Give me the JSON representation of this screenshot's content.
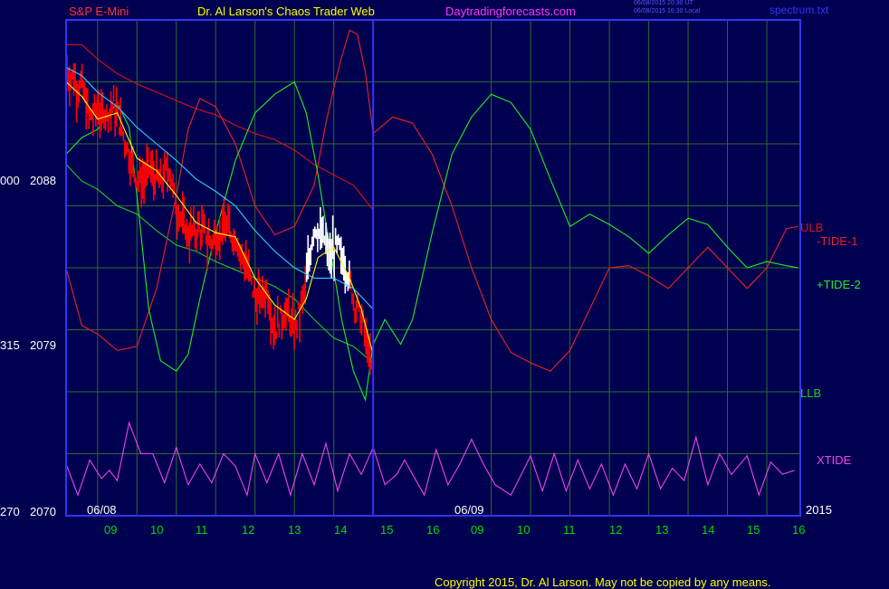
{
  "header": {
    "instrument": "S&P E-Mini",
    "site_title": "Dr. Al Larson's Chaos Trader Web",
    "site_url": "Daytradingforecasts.com",
    "time_line_1": "06/08/2015 20:30 UT",
    "time_line_2": "06/08/2015 16:30 Local",
    "filename": "spectrum.txt"
  },
  "footer": {
    "copyright": "Copyright 2015, Dr. Al Larson. May not be copied by any means."
  },
  "colors": {
    "background": "#000050",
    "frame": "#3333ff",
    "grid": "#2e6b2e",
    "price_bar": "#ff0000",
    "price_bar_forecast": "#ffffff",
    "ulb": "#dd1111",
    "llb": "#22cc22",
    "tide_minus_1": "#ee2222",
    "tide_plus_2": "#22ee22",
    "xtide": "#ee44ee",
    "avg_yellow": "#ffff00",
    "avg_cyan": "#33ccff",
    "header_red": "#ff3333",
    "header_yellow": "#ffff00",
    "header_magenta": "#ff33ff"
  },
  "chart_data": {
    "type": "line",
    "title": "S&P E-Mini",
    "y_axis": {
      "range": [
        2070,
        2094
      ],
      "ticks": [
        {
          "value": 2088,
          "label": "2088",
          "left_label": "000"
        },
        {
          "value": 2079,
          "label": "2079",
          "left_label": "315"
        },
        {
          "value": 2070,
          "label": "2070",
          "left_label": "270"
        }
      ]
    },
    "x_axis": {
      "hours": [
        "09",
        "10",
        "11",
        "12",
        "13",
        "14",
        "15",
        "16",
        "09",
        "10",
        "11",
        "12",
        "13",
        "14",
        "15",
        "16"
      ],
      "date_labels": [
        "06/08",
        "06/09"
      ],
      "year_label": "2015",
      "grid": true
    },
    "legend": [
      {
        "label": "ULB",
        "color": "#dd1111"
      },
      {
        "label": "-TIDE-1",
        "color": "#ee2222"
      },
      {
        "label": "+TIDE-2",
        "color": "#22ee22"
      },
      {
        "label": "LLB",
        "color": "#22cc22"
      },
      {
        "label": "XTIDE",
        "color": "#ee44ee"
      }
    ],
    "price_path": [
      [
        8.2,
        2091.5
      ],
      [
        8.6,
        2090.8
      ],
      [
        8.8,
        2089.2
      ],
      [
        9.0,
        2089.8
      ],
      [
        9.25,
        2089.5
      ],
      [
        9.4,
        2090.0
      ],
      [
        9.6,
        2088.7
      ],
      [
        9.8,
        2087.5
      ],
      [
        10.0,
        2086.2
      ],
      [
        10.3,
        2087.0
      ],
      [
        10.6,
        2086.0
      ],
      [
        10.8,
        2087.0
      ],
      [
        11.0,
        2085.0
      ],
      [
        11.3,
        2083.7
      ],
      [
        11.6,
        2084.0
      ],
      [
        11.9,
        2083.2
      ],
      [
        12.2,
        2084.0
      ],
      [
        12.5,
        2083.5
      ],
      [
        12.8,
        2082.0
      ],
      [
        13.0,
        2080.5
      ],
      [
        13.3,
        2081.0
      ],
      [
        13.5,
        2079.0
      ],
      [
        13.8,
        2080.0
      ],
      [
        14.0,
        2079.0
      ],
      [
        14.2,
        2080.5
      ],
      [
        14.35,
        2082.0
      ],
      [
        14.5,
        2084.0
      ],
      [
        14.7,
        2083.5
      ],
      [
        14.9,
        2082.8
      ],
      [
        15.1,
        2083.0
      ],
      [
        15.3,
        2082.2
      ],
      [
        15.5,
        2080.5
      ],
      [
        15.7,
        2079.5
      ],
      [
        15.85,
        2078.5
      ],
      [
        15.95,
        2077.0
      ],
      [
        16.0,
        2077.3
      ]
    ],
    "forecast_start_hour": 14.3,
    "series": [
      {
        "name": "ULB",
        "color": "#dd1111",
        "points": [
          [
            8.2,
            2092.8
          ],
          [
            8.6,
            2092.8
          ],
          [
            9.0,
            2092.1
          ],
          [
            9.5,
            2091.4
          ],
          [
            10.0,
            2090.9
          ],
          [
            10.5,
            2090.5
          ],
          [
            11.0,
            2090.1
          ],
          [
            11.5,
            2089.7
          ],
          [
            12.0,
            2089.4
          ],
          [
            12.5,
            2088.9
          ],
          [
            13.0,
            2088.5
          ],
          [
            13.5,
            2088.2
          ],
          [
            14.0,
            2087.7
          ],
          [
            14.5,
            2087.0
          ],
          [
            15.0,
            2086.5
          ],
          [
            15.5,
            2086.0
          ],
          [
            16.0,
            2084.8
          ]
        ]
      },
      {
        "name": "LLB",
        "color": "#22cc22",
        "points": [
          [
            8.2,
            2087.0
          ],
          [
            8.6,
            2086.2
          ],
          [
            9.0,
            2085.8
          ],
          [
            9.5,
            2085.0
          ],
          [
            10.0,
            2084.6
          ],
          [
            10.5,
            2083.8
          ],
          [
            11.0,
            2083.1
          ],
          [
            11.5,
            2082.8
          ],
          [
            12.0,
            2082.3
          ],
          [
            12.5,
            2081.9
          ],
          [
            13.0,
            2081.5
          ],
          [
            13.5,
            2081.1
          ],
          [
            14.0,
            2080.5
          ],
          [
            14.5,
            2079.5
          ],
          [
            15.0,
            2078.6
          ],
          [
            15.5,
            2078.2
          ],
          [
            16.0,
            2077.4
          ]
        ]
      },
      {
        "name": "-TIDE-1",
        "color": "#ee2222",
        "points": [
          [
            8.2,
            2082.0
          ],
          [
            8.6,
            2079.2
          ],
          [
            9.0,
            2078.8
          ],
          [
            9.5,
            2078.0
          ],
          [
            10.0,
            2078.2
          ],
          [
            10.5,
            2081.0
          ],
          [
            11.0,
            2085.5
          ],
          [
            11.3,
            2088.7
          ],
          [
            11.6,
            2090.2
          ],
          [
            12.0,
            2089.8
          ],
          [
            12.5,
            2088.0
          ],
          [
            13.0,
            2085.0
          ],
          [
            13.5,
            2083.6
          ],
          [
            14.0,
            2084.0
          ],
          [
            14.5,
            2086.0
          ],
          [
            14.8,
            2089.0
          ],
          [
            15.0,
            2090.7
          ],
          [
            15.2,
            2092.2
          ],
          [
            15.4,
            2093.5
          ],
          [
            15.6,
            2093.3
          ],
          [
            15.8,
            2091.5
          ],
          [
            16.0,
            2088.5
          ],
          [
            16.5,
            2089.3
          ],
          [
            17.0,
            2089.0
          ],
          [
            17.5,
            2087.5
          ],
          [
            18.0,
            2085.0
          ],
          [
            18.5,
            2082.0
          ],
          [
            19.0,
            2079.5
          ],
          [
            19.5,
            2077.9
          ],
          [
            20.0,
            2077.4
          ],
          [
            20.5,
            2077.0
          ],
          [
            21.0,
            2078.0
          ],
          [
            21.5,
            2080.0
          ],
          [
            22.0,
            2082.0
          ],
          [
            22.5,
            2082.1
          ],
          [
            23.0,
            2081.6
          ],
          [
            23.5,
            2081.0
          ],
          [
            24.0,
            2082.0
          ],
          [
            24.5,
            2083.0
          ],
          [
            25.0,
            2082.0
          ],
          [
            25.5,
            2081.0
          ],
          [
            26.0,
            2082.0
          ],
          [
            26.5,
            2083.9
          ],
          [
            26.8,
            2084.0
          ]
        ]
      },
      {
        "name": "+TIDE-2",
        "color": "#22ee22",
        "points": [
          [
            8.2,
            2087.5
          ],
          [
            8.6,
            2088.3
          ],
          [
            9.0,
            2088.7
          ],
          [
            9.5,
            2090.0
          ],
          [
            9.8,
            2088.8
          ],
          [
            10.0,
            2085.5
          ],
          [
            10.3,
            2080.0
          ],
          [
            10.6,
            2077.5
          ],
          [
            11.0,
            2077.0
          ],
          [
            11.3,
            2077.8
          ],
          [
            11.6,
            2080.5
          ],
          [
            12.0,
            2083.7
          ],
          [
            12.5,
            2087.2
          ],
          [
            13.0,
            2089.5
          ],
          [
            13.5,
            2090.4
          ],
          [
            14.0,
            2091.0
          ],
          [
            14.3,
            2089.5
          ],
          [
            14.6,
            2086.5
          ],
          [
            14.9,
            2083.0
          ],
          [
            15.2,
            2079.5
          ],
          [
            15.5,
            2077.0
          ],
          [
            15.8,
            2075.6
          ],
          [
            16.0,
            2078.3
          ],
          [
            16.3,
            2079.5
          ],
          [
            16.7,
            2078.3
          ],
          [
            17.0,
            2079.5
          ],
          [
            17.5,
            2083.7
          ],
          [
            18.0,
            2087.5
          ],
          [
            18.5,
            2089.3
          ],
          [
            19.0,
            2090.4
          ],
          [
            19.5,
            2090.0
          ],
          [
            20.0,
            2088.7
          ],
          [
            20.5,
            2086.3
          ],
          [
            21.0,
            2084.0
          ],
          [
            21.5,
            2084.6
          ],
          [
            22.0,
            2084.1
          ],
          [
            22.5,
            2083.5
          ],
          [
            23.0,
            2082.7
          ],
          [
            23.5,
            2083.6
          ],
          [
            24.0,
            2084.4
          ],
          [
            24.5,
            2084.1
          ],
          [
            25.0,
            2083.0
          ],
          [
            25.5,
            2082.0
          ],
          [
            26.0,
            2082.3
          ],
          [
            26.5,
            2082.1
          ],
          [
            26.8,
            2082.0
          ]
        ]
      },
      {
        "name": "XTIDE",
        "color": "#ee44ee",
        "points": [
          [
            8.2,
            2072.5
          ],
          [
            8.5,
            2071.0
          ],
          [
            8.8,
            2072.7
          ],
          [
            9.1,
            2071.8
          ],
          [
            9.3,
            2072.2
          ],
          [
            9.5,
            2071.7
          ],
          [
            9.8,
            2074.5
          ],
          [
            10.1,
            2073.0
          ],
          [
            10.4,
            2073.0
          ],
          [
            10.7,
            2071.6
          ],
          [
            11.0,
            2073.3
          ],
          [
            11.3,
            2071.5
          ],
          [
            11.6,
            2072.5
          ],
          [
            11.9,
            2071.6
          ],
          [
            12.2,
            2073.0
          ],
          [
            12.5,
            2072.4
          ],
          [
            12.8,
            2071.0
          ],
          [
            13.0,
            2073.0
          ],
          [
            13.3,
            2071.6
          ],
          [
            13.6,
            2073.0
          ],
          [
            13.9,
            2071.0
          ],
          [
            14.2,
            2073.0
          ],
          [
            14.5,
            2071.5
          ],
          [
            14.8,
            2073.5
          ],
          [
            15.1,
            2071.2
          ],
          [
            15.4,
            2073.0
          ],
          [
            15.7,
            2072.0
          ],
          [
            16.0,
            2073.3
          ],
          [
            16.3,
            2071.5
          ],
          [
            16.6,
            2072.0
          ],
          [
            16.8,
            2072.7
          ],
          [
            17.0,
            2072.0
          ],
          [
            17.3,
            2071.0
          ],
          [
            17.6,
            2073.2
          ],
          [
            17.9,
            2071.5
          ],
          [
            18.2,
            2072.5
          ],
          [
            18.5,
            2073.7
          ],
          [
            18.8,
            2072.5
          ],
          [
            19.1,
            2071.5
          ],
          [
            19.5,
            2071.0
          ],
          [
            20.0,
            2072.9
          ],
          [
            20.3,
            2071.2
          ],
          [
            20.6,
            2073.0
          ],
          [
            20.9,
            2071.2
          ],
          [
            21.2,
            2072.7
          ],
          [
            21.5,
            2071.3
          ],
          [
            21.8,
            2072.5
          ],
          [
            22.1,
            2071.0
          ],
          [
            22.4,
            2072.5
          ],
          [
            22.7,
            2071.3
          ],
          [
            23.0,
            2073.0
          ],
          [
            23.3,
            2071.3
          ],
          [
            23.6,
            2072.3
          ],
          [
            23.9,
            2071.7
          ],
          [
            24.2,
            2073.8
          ],
          [
            24.5,
            2071.5
          ],
          [
            24.8,
            2073.0
          ],
          [
            25.1,
            2072.0
          ],
          [
            25.5,
            2072.9
          ],
          [
            25.8,
            2071.0
          ],
          [
            26.1,
            2072.6
          ],
          [
            26.4,
            2072.0
          ],
          [
            26.7,
            2072.2
          ]
        ]
      },
      {
        "name": "yellow average",
        "color": "#ffff00",
        "points": [
          [
            8.2,
            2091.0
          ],
          [
            8.6,
            2090.3
          ],
          [
            9.0,
            2089.2
          ],
          [
            9.5,
            2089.5
          ],
          [
            10.0,
            2087.3
          ],
          [
            10.5,
            2086.7
          ],
          [
            11.0,
            2085.5
          ],
          [
            11.5,
            2084.2
          ],
          [
            12.0,
            2083.7
          ],
          [
            12.5,
            2083.5
          ],
          [
            13.0,
            2081.5
          ],
          [
            13.5,
            2080.2
          ],
          [
            14.0,
            2079.5
          ],
          [
            14.3,
            2080.5
          ],
          [
            14.6,
            2082.5
          ],
          [
            15.0,
            2083.0
          ],
          [
            15.4,
            2081.5
          ],
          [
            15.7,
            2080.0
          ],
          [
            16.0,
            2077.8
          ]
        ]
      },
      {
        "name": "cyan average",
        "color": "#33ccff",
        "points": [
          [
            8.2,
            2091.7
          ],
          [
            8.6,
            2091.3
          ],
          [
            9.0,
            2090.5
          ],
          [
            9.5,
            2089.8
          ],
          [
            10.0,
            2088.8
          ],
          [
            10.5,
            2088.0
          ],
          [
            11.0,
            2087.2
          ],
          [
            11.5,
            2086.3
          ],
          [
            12.0,
            2085.7
          ],
          [
            12.5,
            2085.0
          ],
          [
            13.0,
            2083.8
          ],
          [
            13.5,
            2082.8
          ],
          [
            14.0,
            2082.0
          ],
          [
            14.5,
            2081.5
          ],
          [
            15.0,
            2081.5
          ],
          [
            15.5,
            2081.0
          ],
          [
            16.0,
            2080.0
          ]
        ]
      }
    ]
  }
}
